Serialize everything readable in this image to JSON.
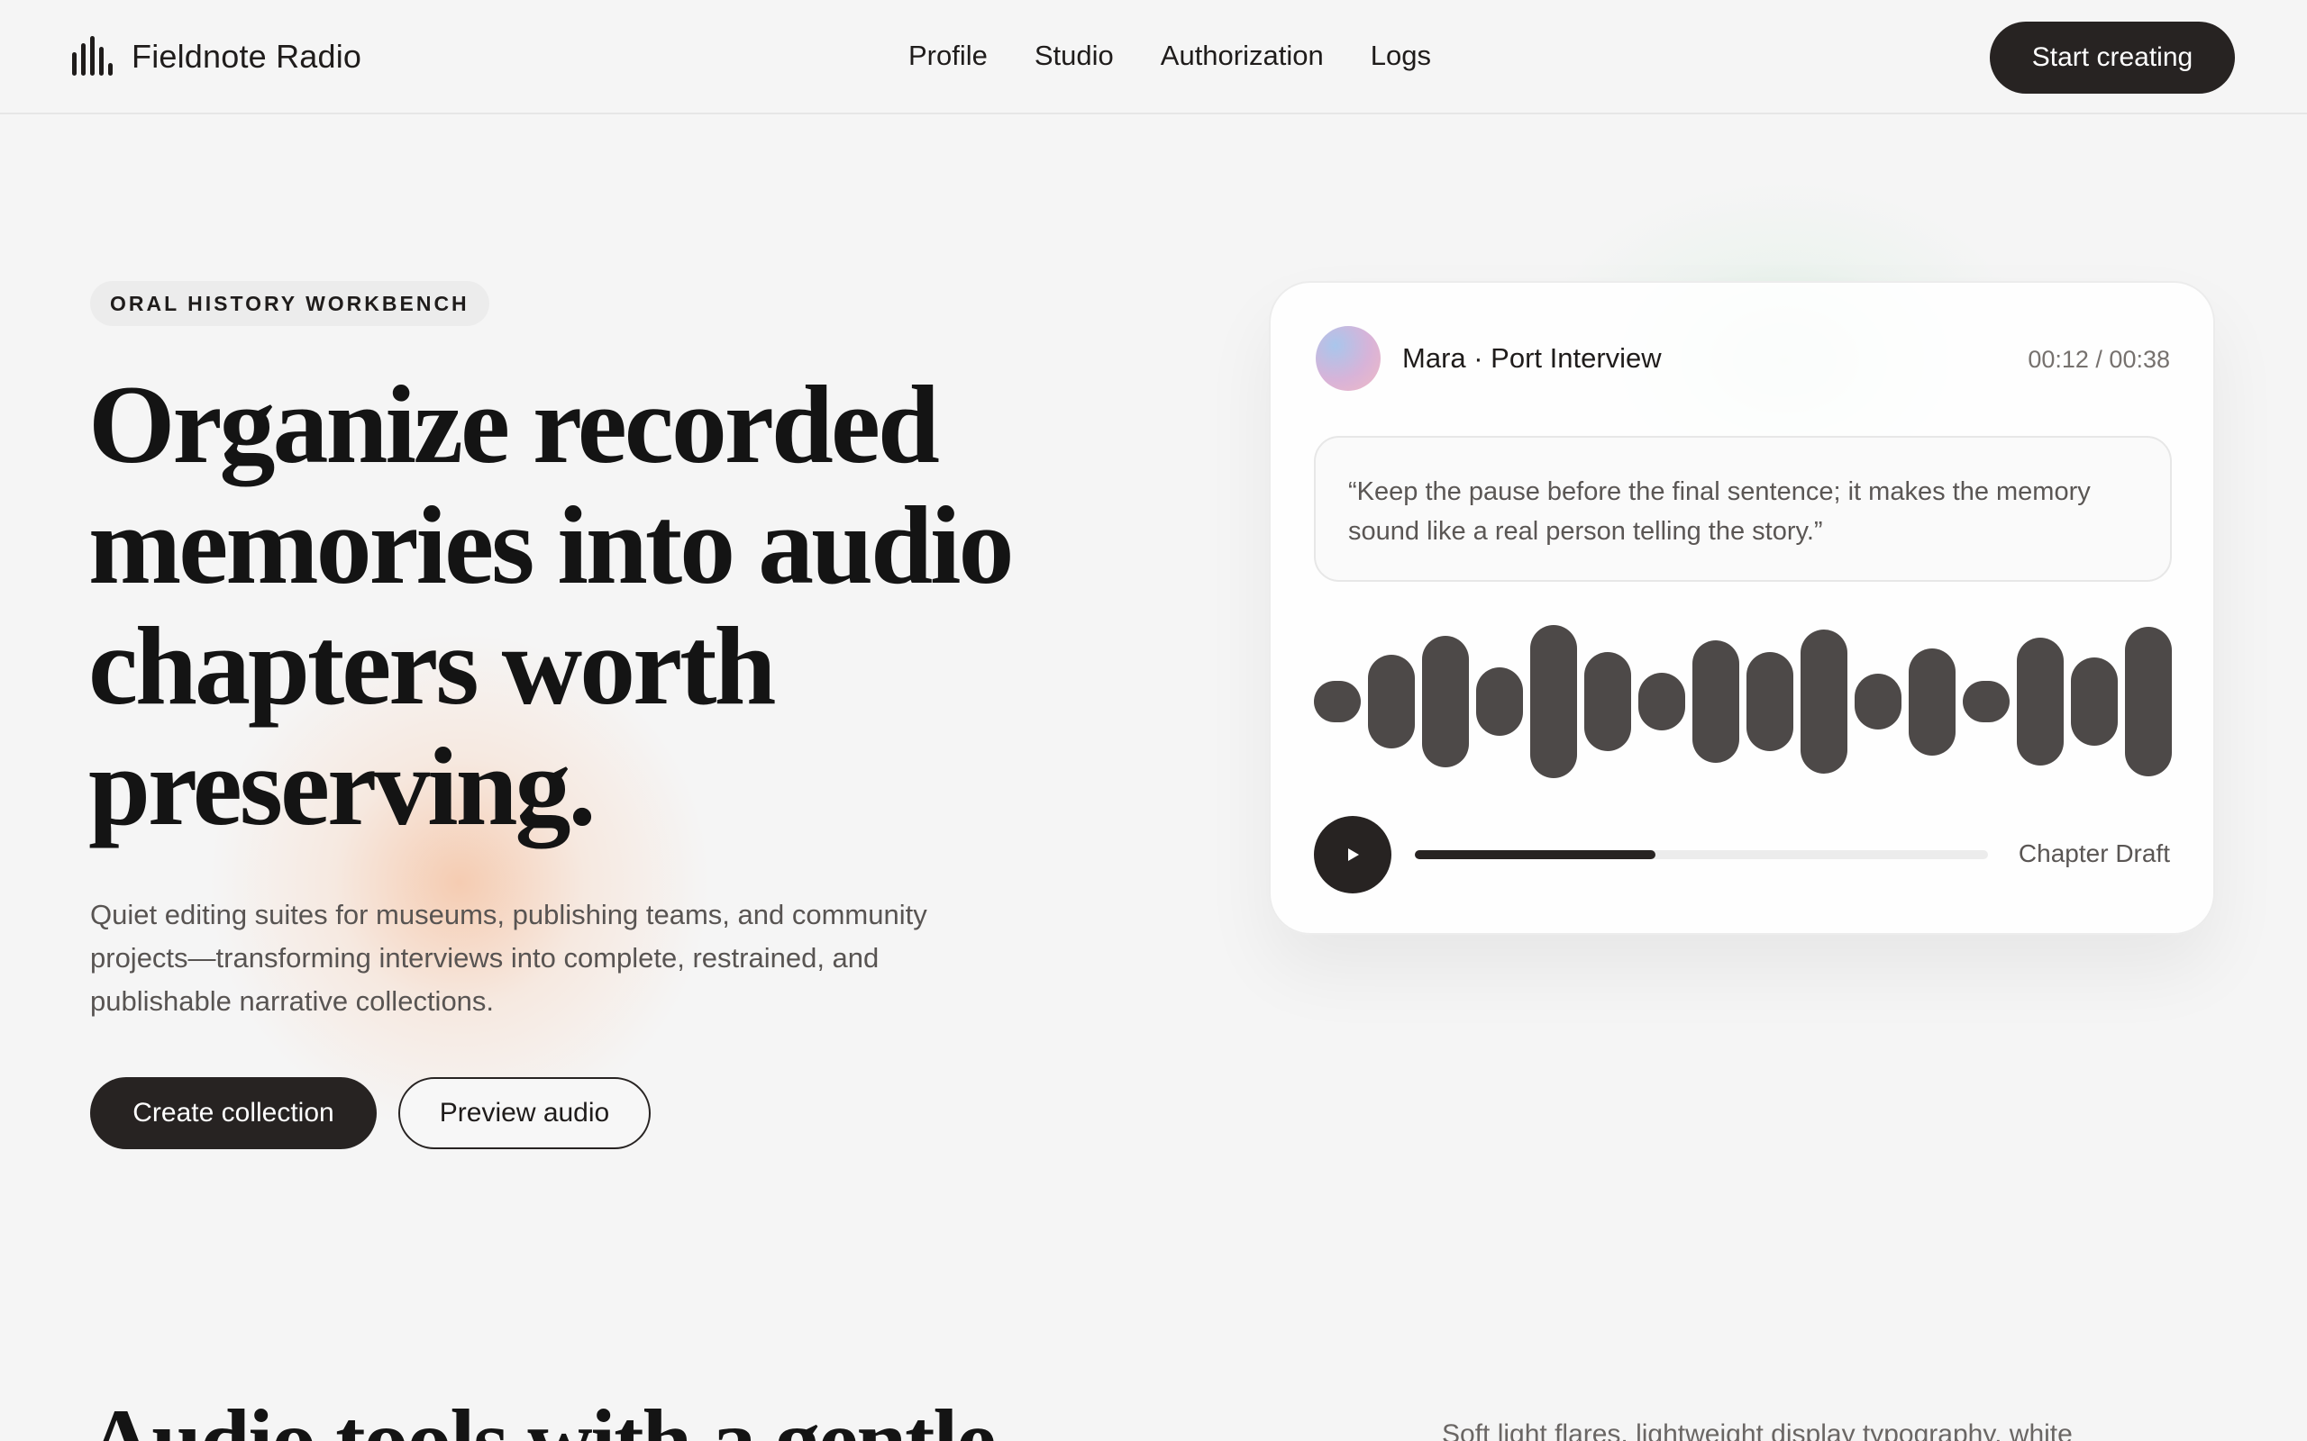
{
  "header": {
    "brand_name": "Fieldnote Radio",
    "brand_icon": "audio-bars-icon",
    "nav": [
      "Profile",
      "Studio",
      "Authorization",
      "Logs"
    ],
    "cta_label": "Start creating"
  },
  "hero": {
    "eyebrow": "ORAL HISTORY WORKBENCH",
    "headline": "Organize recorded memories into audio chapters worth preserving.",
    "lede": "Quiet editing suites for museums, publishing teams, and community projects—transforming interviews into complete, restrained, and publishable narrative collections.",
    "primary_button": "Create collection",
    "secondary_button": "Preview audio"
  },
  "player": {
    "track_title": "Mara · Port Interview",
    "time": "00:12 / 00:38",
    "quote": "“Keep the pause before the final sentence; it makes the memory sound like a real person telling the story.”",
    "waveform_levels": [
      0.27,
      0.61,
      0.86,
      0.45,
      1.0,
      0.65,
      0.38,
      0.8,
      0.65,
      0.94,
      0.36,
      0.7,
      0.27,
      0.84,
      0.58,
      0.98
    ],
    "progress_fraction": 0.42,
    "chapter_label": "Chapter Draft",
    "play_icon": "play-icon"
  },
  "section": {
    "title": "Audio tools with a gentle",
    "lede": "Soft light flares, lightweight display typography, white"
  },
  "colors": {
    "background": "#f5f5f5",
    "ink": "#272322",
    "waveform": "#4d4948",
    "muted_text": "#585452"
  }
}
